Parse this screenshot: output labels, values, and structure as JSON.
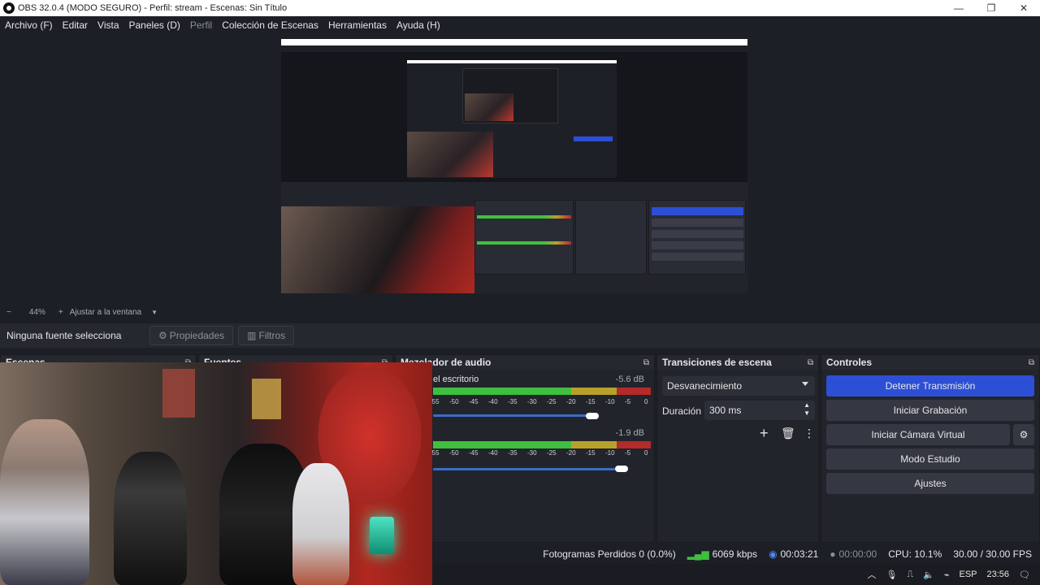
{
  "window": {
    "title": "OBS 32.0.4 (MODO SEGURO) - Perfil: stream - Escenas: Sin Título",
    "minimize": "—",
    "maximize": "❐",
    "close": "✕"
  },
  "menu": [
    "Archivo (F)",
    "Editar",
    "Vista",
    "Paneles (D)",
    "Perfil",
    "Colección de Escenas",
    "Herramientas",
    "Ayuda (H)"
  ],
  "zoom": {
    "minus": "−",
    "value": "44%",
    "plus": "+",
    "fit_label": "Ajustar a la ventana"
  },
  "context": {
    "no_source": "Ninguna fuente selecciona",
    "properties": "Propiedades",
    "filters": "Filtros"
  },
  "docks": {
    "scenes": "Escenas",
    "sources": "Fuentes",
    "audio_mixer": "Mezclador de audio",
    "transitions": "Transiciones de escena",
    "controls": "Controles"
  },
  "audio": {
    "tracks": [
      {
        "name": "el escritorio",
        "db": "-5.6 dB",
        "volume": 0.73
      },
      {
        "name": "",
        "db": "-1.9 dB",
        "volume": 0.87
      }
    ],
    "ticks": [
      "-55",
      "-50",
      "-45",
      "-40",
      "-35",
      "-30",
      "-25",
      "-20",
      "-15",
      "-10",
      "-5",
      "0"
    ]
  },
  "transitions": {
    "selected": "Desvanecimiento",
    "duration_label": "Duración",
    "duration_value": "300 ms"
  },
  "controls": {
    "stop_stream": "Detener Transmisión",
    "start_recording": "Iniciar Grabación",
    "start_virtual_cam": "Iniciar Cámara Virtual",
    "studio_mode": "Modo Estudio",
    "settings": "Ajustes"
  },
  "status": {
    "dropped_frames": "Fotogramas Perdidos 0 (0.0%)",
    "bitrate": "6069 kbps",
    "stream_time": "00:03:21",
    "record_time": "00:00:00",
    "cpu": "CPU: 10.1%",
    "fps": "30.00 / 30.00 FPS"
  },
  "taskbar": {
    "lang": "ESP",
    "time": "23:56"
  },
  "colors": {
    "accent": "#2d4fd6",
    "meter_green": "#3fbf3f",
    "meter_yellow": "#b8a12a",
    "meter_red": "#b52a2a"
  }
}
